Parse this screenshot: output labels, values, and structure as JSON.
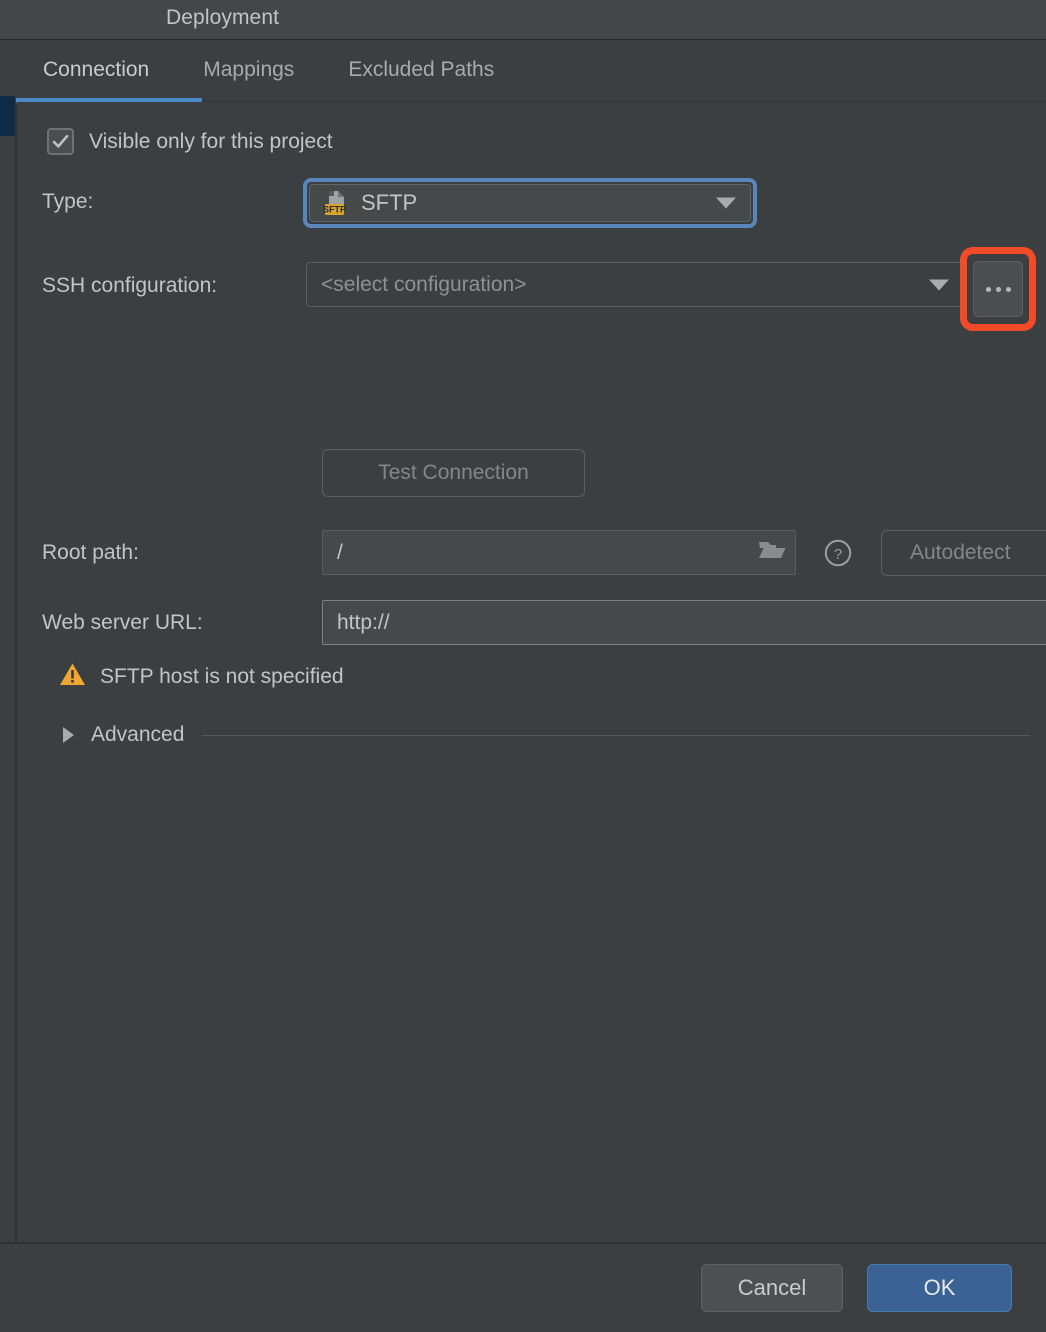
{
  "window": {
    "title": "Deployment"
  },
  "tabs": [
    {
      "label": "Connection",
      "active": true
    },
    {
      "label": "Mappings",
      "active": false
    },
    {
      "label": "Excluded Paths",
      "active": false
    }
  ],
  "form": {
    "visible_only_checkbox": {
      "label": "Visible only for this project",
      "checked": true
    },
    "type": {
      "label": "Type:",
      "value": "SFTP",
      "icon": "sftp-file-icon",
      "icon_badge": "SFTP",
      "focused": true
    },
    "ssh_configuration": {
      "label": "SSH configuration:",
      "value": "<select configuration>",
      "browse_button": "...",
      "highlighted": true
    },
    "test_connection": {
      "label": "Test Connection",
      "enabled": false
    },
    "root_path": {
      "label": "Root path:",
      "value": "/",
      "browse_icon": "folder-open-icon",
      "help_icon": "question-circle-icon",
      "autodetect_label": "Autodetect",
      "autodetect_enabled": false
    },
    "web_server_url": {
      "label": "Web server URL:",
      "value": "http://"
    },
    "warning": {
      "icon": "warning-triangle-icon",
      "text": "SFTP host is not specified"
    },
    "advanced": {
      "label": "Advanced",
      "expanded": false,
      "arrow_icon": "chevron-right-icon"
    }
  },
  "footer": {
    "cancel_label": "Cancel",
    "ok_label": "OK"
  },
  "colors": {
    "background": "#3c3f41",
    "titlebar": "#434749",
    "accent_blue": "#4a88c7",
    "focus_ring": "#5a87bb",
    "highlight_red": "#f24b28",
    "warning_amber": "#f0a732",
    "ok_button": "#3a6294",
    "selection_navy": "#0d2c45",
    "text_primary": "#c3c4c4",
    "text_muted": "#83878a"
  }
}
